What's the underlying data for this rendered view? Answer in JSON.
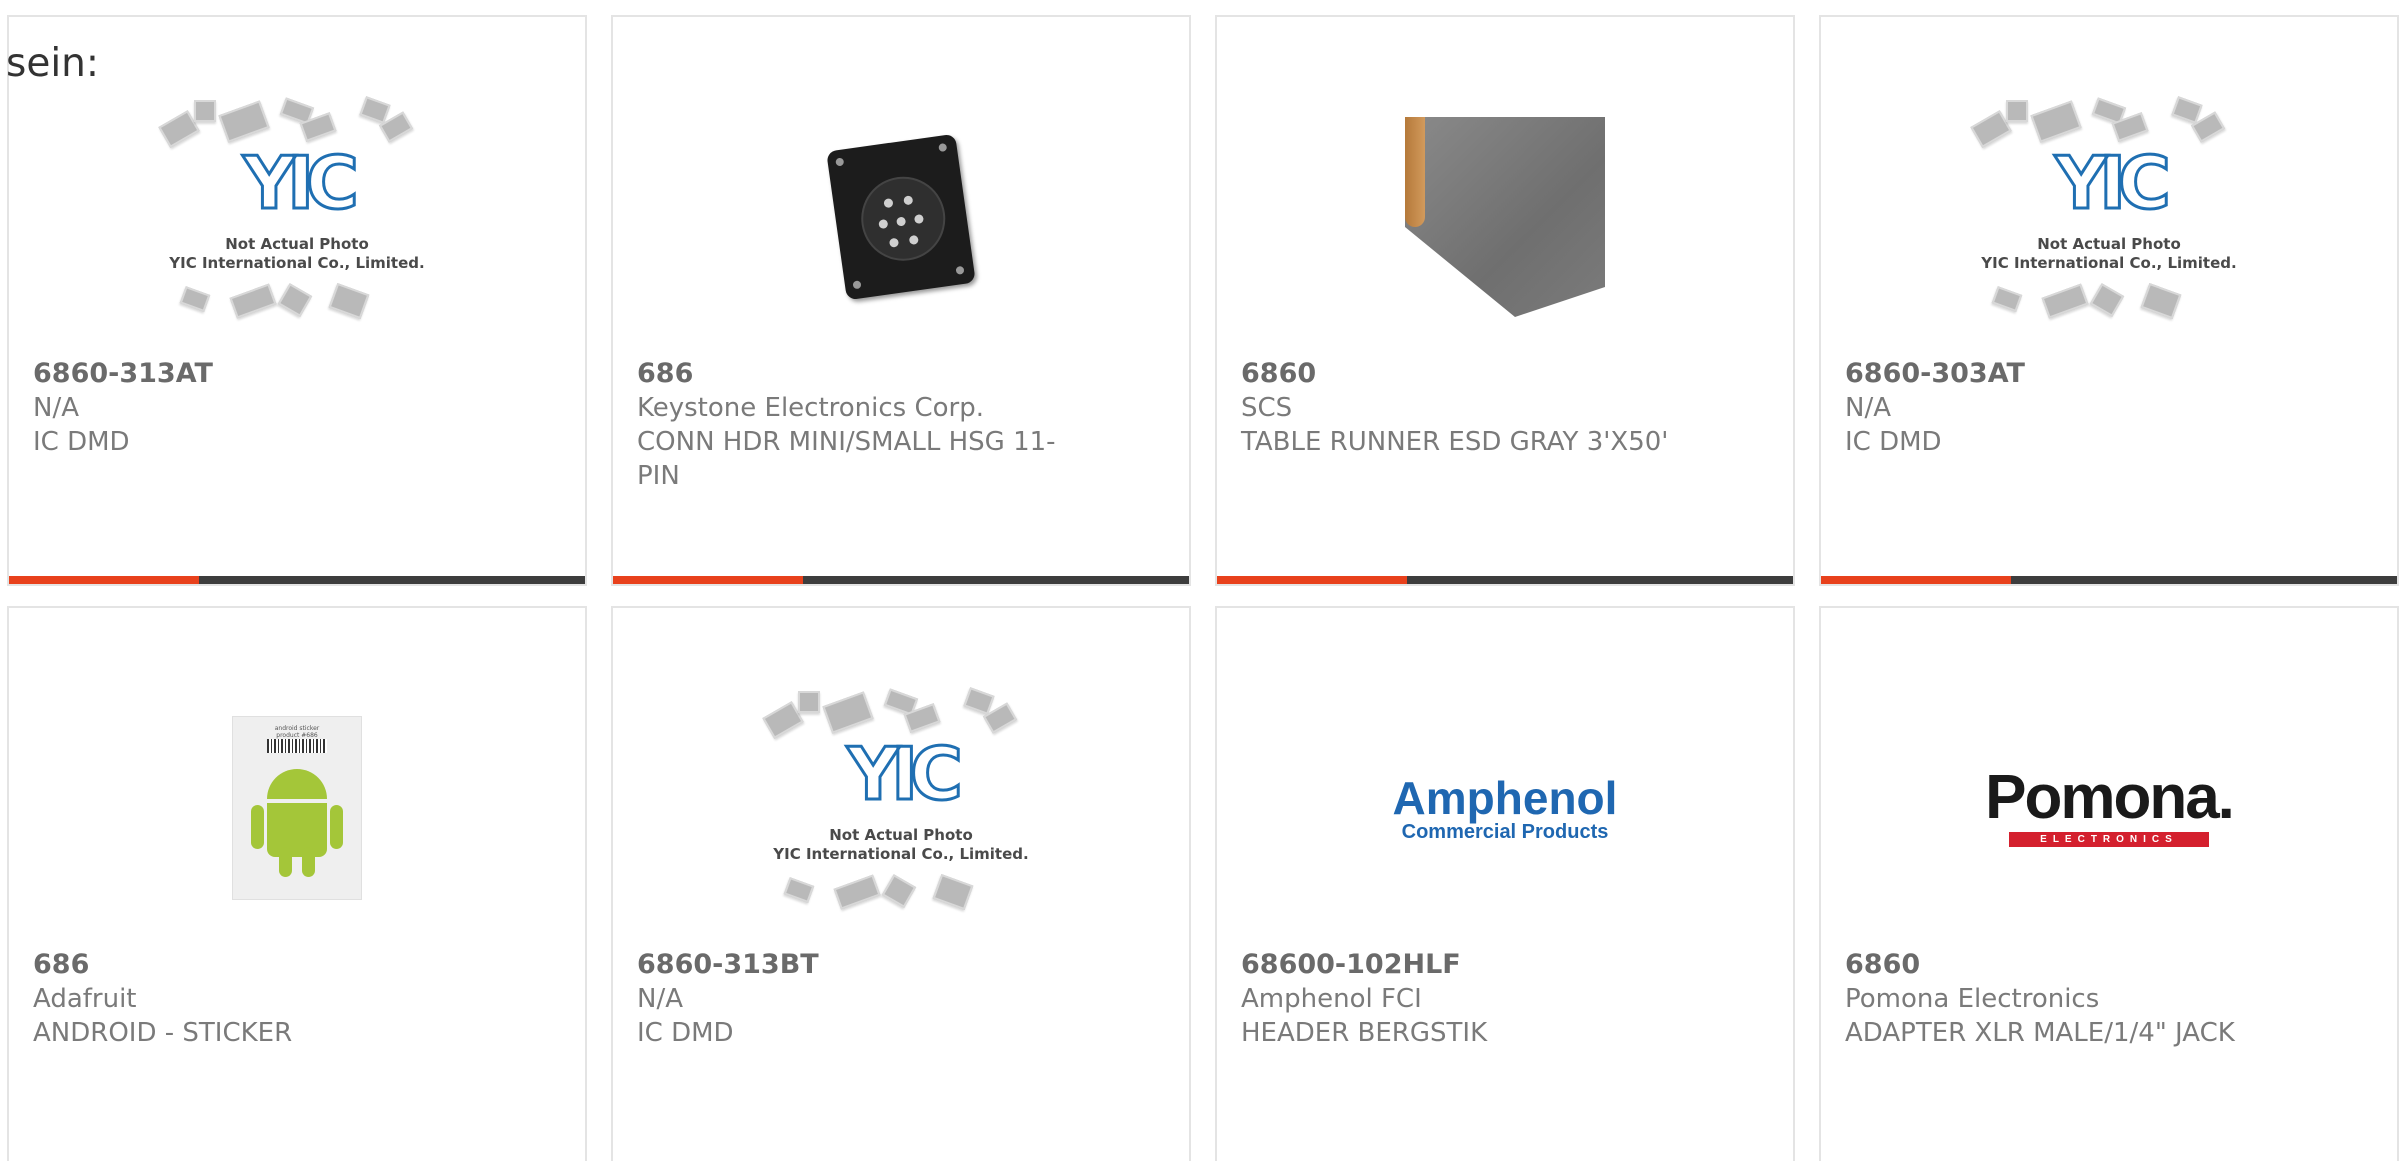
{
  "lead_text": "sein:",
  "colors": {
    "accent": "#e8411c",
    "bar_track": "#3d3d3d",
    "card_border": "#e4e4e4"
  },
  "yic_placeholder": {
    "logo_text": "YIC",
    "caption_line1": "Not Actual Photo",
    "caption_line2": "YIC International Co., Limited."
  },
  "brand_logos": {
    "amphenol": {
      "main": "Amphenol",
      "sub": "Commercial Products"
    },
    "pomona": {
      "main": "Pomona.",
      "sub": "ELECTRONICS"
    }
  },
  "sticker_barcode_text": [
    "android sticker",
    "product #686"
  ],
  "products": [
    {
      "part_number": "6860-313AT",
      "manufacturer": "N/A",
      "description": "IC DMD",
      "image": "yic-placeholder-icon",
      "progress": 0.33
    },
    {
      "part_number": "686",
      "manufacturer": "Keystone Electronics Corp.",
      "description": "CONN HDR MINI/SMALL HSG 11-PIN",
      "image": "connector-photo",
      "progress": 0.33
    },
    {
      "part_number": "6860",
      "manufacturer": "SCS",
      "description": "TABLE RUNNER ESD GRAY 3'X50'",
      "image": "table-runner-photo",
      "progress": 0.33
    },
    {
      "part_number": "6860-303AT",
      "manufacturer": "N/A",
      "description": "IC DMD",
      "image": "yic-placeholder-icon",
      "progress": 0.33
    },
    {
      "part_number": "686",
      "manufacturer": "Adafruit",
      "description": "ANDROID - STICKER",
      "image": "android-sticker-photo"
    },
    {
      "part_number": "6860-313BT",
      "manufacturer": "N/A",
      "description": "IC DMD",
      "image": "yic-placeholder-icon"
    },
    {
      "part_number": "68600-102HLF",
      "manufacturer": "Amphenol FCI",
      "description": "HEADER BERGSTIK",
      "image": "amphenol-logo"
    },
    {
      "part_number": "6860",
      "manufacturer": "Pomona Electronics",
      "description": "ADAPTER XLR MALE/1/4\" JACK",
      "image": "pomona-logo"
    }
  ]
}
